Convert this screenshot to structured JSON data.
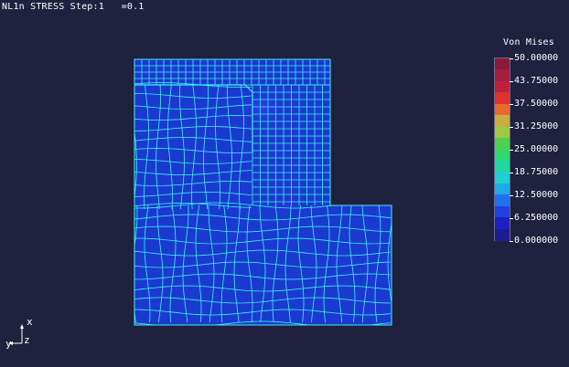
{
  "header": {
    "result_title": "NL1n STRESS Step:1   =0.1"
  },
  "legend": {
    "title": "Von Mises",
    "labels": [
      "50.00000",
      "43.75000",
      "37.50000",
      "31.25000",
      "25.00000",
      "18.75000",
      "12.50000",
      "6.250000",
      "0.000000"
    ],
    "values": [
      50.0,
      43.75,
      37.5,
      31.25,
      25.0,
      18.75,
      12.5,
      6.25,
      0.0
    ],
    "band_colors": [
      "#8b1a3a",
      "#a31f3f",
      "#c02040",
      "#e03030",
      "#e86a30",
      "#c8b040",
      "#a0c840",
      "#50d050",
      "#30d870",
      "#20d8a0",
      "#20d0d0",
      "#20a8e8",
      "#2070f0",
      "#2040e0",
      "#2020c0",
      "#1c1c90"
    ]
  },
  "triad": {
    "x_label": "x",
    "y_label": "y",
    "z_label": "z"
  },
  "colors": {
    "background": "#20203f",
    "mesh_line": "#40f0f0",
    "mesh_fill": "#1a3acf",
    "stress_hotspot": "#2a2ae8"
  }
}
